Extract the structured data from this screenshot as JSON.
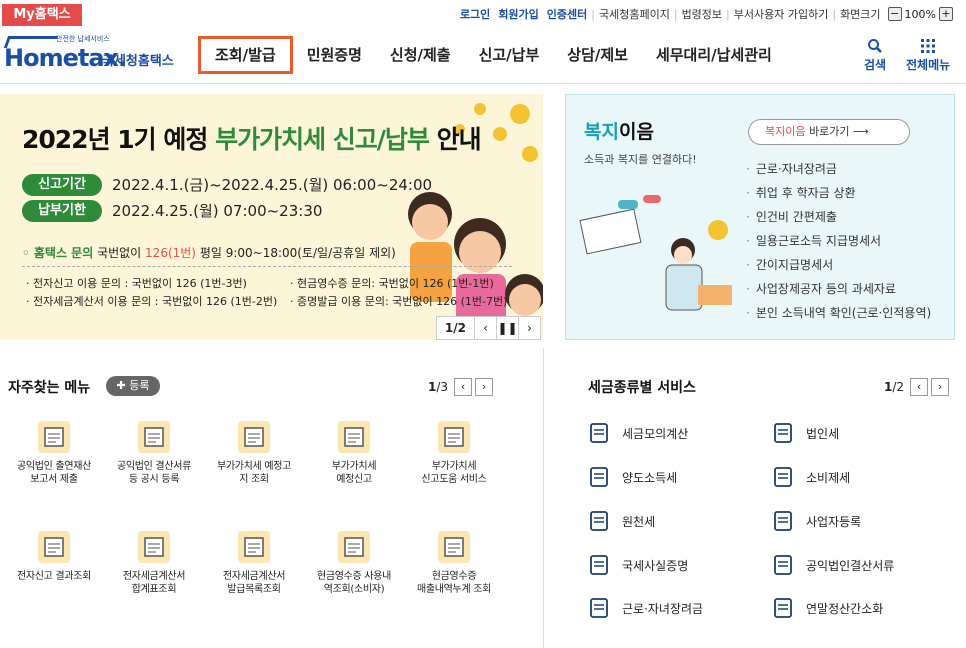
{
  "topbar": {
    "myhometax": "My홈택스",
    "login": "로그인",
    "join": "회원가입",
    "cert": "인증센터",
    "links": [
      "국세청홈페이지",
      "법령정보",
      "부서사용자 가입하기",
      "화면크기"
    ],
    "zoom": "100%",
    "zoom_minus": "−",
    "zoom_plus": "+"
  },
  "header": {
    "logo_main": "Hometax.",
    "logo_sub": "국세청홈택스",
    "logo_tag": "안전한 납세서비스",
    "nav": [
      "조회/발급",
      "민원증명",
      "신청/제출",
      "신고/납부",
      "상담/제보",
      "세무대리/납세관리"
    ],
    "search": "검색",
    "allmenu": "전체메뉴"
  },
  "banner": {
    "title_a": "2022년 1기 예정 ",
    "title_b": "부가가치세 신고/납부",
    "title_c": " 안내",
    "pill1": "신고기간",
    "period1": "2022.4.1.(금)~2022.4.25.(월) 06:00~24:00",
    "pill2": "납부기한",
    "period2": "2022.4.25.(월) 07:00~23:30",
    "inq_a": "홈택스 문의",
    "inq_b": " 국번없이 ",
    "inq_c": "126(1번)",
    "inq_d": " 평일 9:00~18:00(토/일/공휴일 제외)",
    "row1a": "· 전자신고 이용 문의 : 국번없이 126 (1번-3번)",
    "row1b": "· 현금영수증 문의: 국번없이 126 (1번-1번)",
    "row2a": "· 전자세금계산서 이용 문의 : 국번없이 126 (1번-2번)",
    "row2b": "· 증명발급 이용 문의: 국번없이 126 (1번-7번)",
    "page": "1/2"
  },
  "welfare": {
    "title_a": "복지",
    "title_b": "이음",
    "subtitle": "소득과 복지를 연결하다!",
    "btn_a": "복지이음",
    "btn_b": " 바로가기 ⟶",
    "items": [
      "근로·자녀장려금",
      "취업 후 학자금 상환",
      "인건비 간편제출",
      "일용근로소득 지급명세서",
      "간이지급명세서",
      "사업장제공자 등의 과세자료",
      "본인 소득내역 확인(근로·인적용역)"
    ]
  },
  "frequent": {
    "title": "자주찾는 메뉴",
    "register": "✚ 등록",
    "page_cur": "1",
    "page_total": "/3",
    "items": [
      {
        "l1": "공익법인 출연재산",
        "l2": "보고서 제출"
      },
      {
        "l1": "공익법인 결산서류",
        "l2": "등 공시 등록"
      },
      {
        "l1": "부가가치세 예정고",
        "l2": "지 조회"
      },
      {
        "l1": "부가가치세",
        "l2": "예정신고"
      },
      {
        "l1": "부가가치세",
        "l2": "신고도움 서비스"
      },
      {
        "l1": "전자신고 결과조회",
        "l2": ""
      },
      {
        "l1": "전자세금계산서",
        "l2": "합계표조회"
      },
      {
        "l1": "전자세금계산서",
        "l2": "발급목록조회"
      },
      {
        "l1": "현금영수증 사용내",
        "l2": "역조회(소비자)"
      },
      {
        "l1": "현금영수증",
        "l2": "매출내역누계 조회"
      }
    ]
  },
  "taxservice": {
    "title": "세금종류별 서비스",
    "page_cur": "1",
    "page_total": "/2",
    "items": [
      "세금모의계산",
      "법인세",
      "양도소득세",
      "소비제세",
      "원천세",
      "사업자등록",
      "국세사실증명",
      "공익법인결산서류",
      "근로·자녀장려금",
      "연말정산간소화"
    ]
  },
  "colors": {
    "accent": "#1b4fa5",
    "green": "#2e8b3a",
    "nav_active": "#e85c2c",
    "teal": "#17a0b5"
  }
}
